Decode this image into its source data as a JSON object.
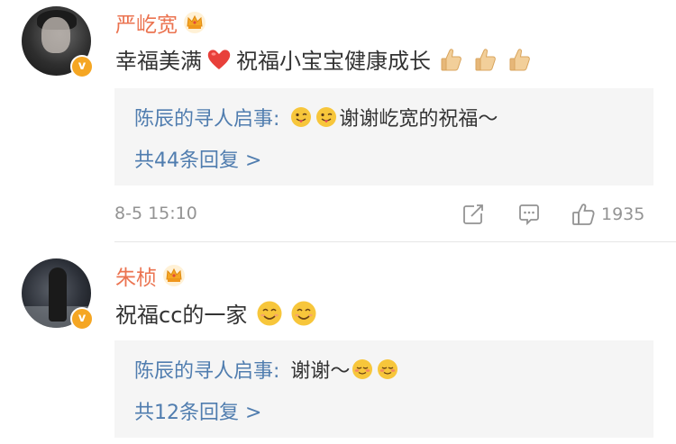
{
  "comments": [
    {
      "username": "严屹宽",
      "content_part1": "幸福美满",
      "content_part2": "祝福小宝宝健康成长",
      "reply_user": "陈辰的寻人启事:",
      "reply_text": "谢谢屹宽的祝福～",
      "reply_count": "共44条回复 >",
      "timestamp": "8-5 15:10",
      "likes": "1935"
    },
    {
      "username": "朱桢",
      "content_part1": "祝福cc的一家",
      "reply_user": "陈辰的寻人启事:",
      "reply_text": "谢谢～",
      "reply_count": "共12条回复 >"
    }
  ],
  "verified_badge": "v",
  "colors": {
    "username": "#eb7350",
    "link": "#507daf",
    "meta": "#939393",
    "badge": "#f5a623"
  },
  "icons": [
    "crown-icon",
    "heart-icon",
    "thumbs-up-icon",
    "tongue-out-emoji-icon",
    "smile-emoji-icon",
    "blush-emoji-icon",
    "share-icon",
    "comment-icon",
    "like-icon"
  ]
}
